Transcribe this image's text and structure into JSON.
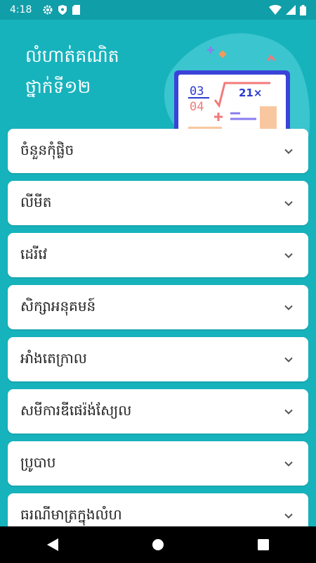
{
  "status_bar": {
    "time": "4:18",
    "left_icons": [
      "gear-icon",
      "shield-icon",
      "sd-card-icon"
    ],
    "right_icons": [
      "wifi-icon",
      "signal-icon",
      "battery-icon"
    ]
  },
  "header": {
    "title": "លំហាត់គណិត\nថ្នាក់ទី១២",
    "illustration_text": {
      "fraction_top": "03",
      "fraction_bottom": "04",
      "formula": "21×"
    }
  },
  "topics": [
    {
      "label": "ចំនួនកុំផ្លិច"
    },
    {
      "label": "លីមីត"
    },
    {
      "label": "ដេរីវេ"
    },
    {
      "label": "សិក្សាអនុគមន៍"
    },
    {
      "label": "អាំងតេក្រាល"
    },
    {
      "label": "សមីការឌីផេរ៉ង់ស្យែល"
    },
    {
      "label": "ប្រូបាប"
    },
    {
      "label": "ធរណីមាត្រក្នុងលំហ"
    }
  ],
  "colors": {
    "background": "#17b3bd",
    "status_bar": "#109ea8",
    "card": "#ffffff"
  }
}
